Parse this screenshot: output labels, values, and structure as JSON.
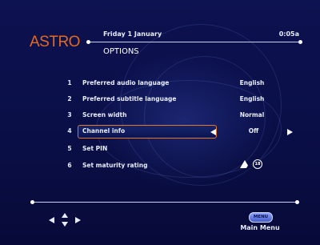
{
  "brand": {
    "logo": "ASTRO"
  },
  "header": {
    "date": "Friday 1 January",
    "time": "0:05a",
    "section_title": "OPTIONS"
  },
  "options": [
    {
      "num": "1",
      "label": "Preferred audio language",
      "value": "English"
    },
    {
      "num": "2",
      "label": "Preferred subtitle language",
      "value": "English"
    },
    {
      "num": "3",
      "label": "Screen width",
      "value": "Normal"
    },
    {
      "num": "4",
      "label": "Channel info",
      "value": "Off",
      "selected": true
    },
    {
      "num": "5",
      "label": "Set PIN",
      "value": ""
    },
    {
      "num": "6",
      "label": "Set maturity rating",
      "value": "",
      "icons": [
        "warning-triangle-icon",
        "rating-18-icon"
      ],
      "icon_texts": [
        "A",
        "18"
      ]
    }
  ],
  "footer": {
    "menu_button": "MENU",
    "menu_label": "Main Menu",
    "nav_icon": "direction-arrows-icon"
  },
  "colors": {
    "accent": "#e3782a",
    "background": "#0a0e44",
    "text": "#e8ecff"
  }
}
